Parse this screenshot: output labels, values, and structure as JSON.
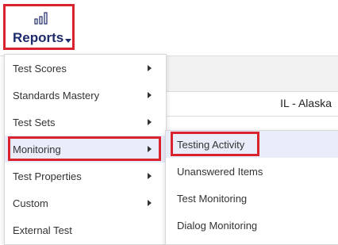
{
  "header": {
    "reports_label": "Reports",
    "reports_icon": "bar-chart-icon",
    "accent_color": "#1d2a6b",
    "highlight_border_color": "#d9232e"
  },
  "context": {
    "state": "IL - Alaska"
  },
  "reports_menu": {
    "items": [
      {
        "label": "Test Scores",
        "has_submenu": true
      },
      {
        "label": "Standards Mastery",
        "has_submenu": true
      },
      {
        "label": "Test Sets",
        "has_submenu": true
      },
      {
        "label": "Monitoring",
        "has_submenu": true,
        "active": true
      },
      {
        "label": "Test Properties",
        "has_submenu": true
      },
      {
        "label": "Custom",
        "has_submenu": true
      },
      {
        "label": "External Test",
        "has_submenu": false
      }
    ]
  },
  "monitoring_submenu": {
    "items": [
      {
        "label": "Testing Activity",
        "highlighted": true
      },
      {
        "label": "Unanswered Items"
      },
      {
        "label": "Test Monitoring"
      },
      {
        "label": "Dialog Monitoring"
      }
    ]
  }
}
